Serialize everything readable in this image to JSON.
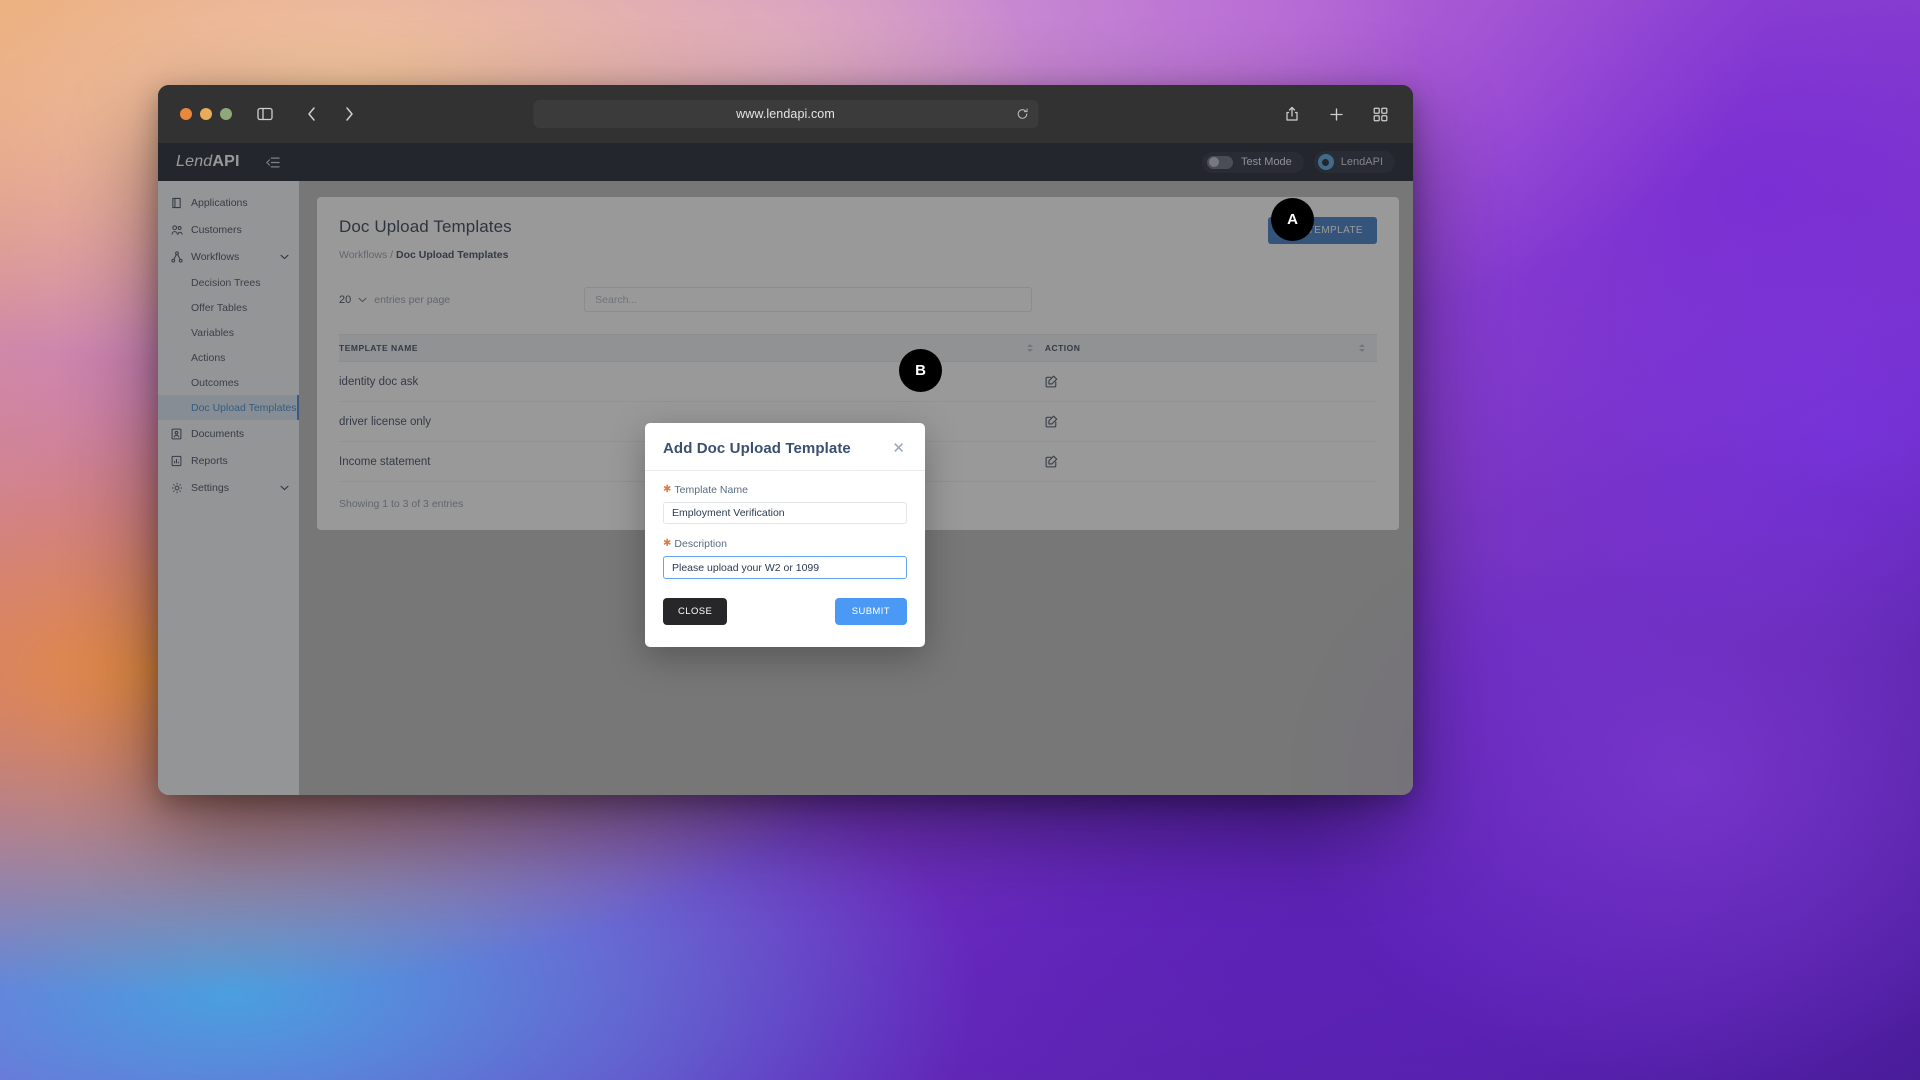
{
  "browser": {
    "url": "www.lendapi.com",
    "traffic_lights": [
      "close",
      "minimize",
      "maximize"
    ],
    "icons": {
      "sidebar_toggle": "sidebar-toggle-icon",
      "back": "back-arrow-icon",
      "forward": "forward-arrow-icon",
      "reload": "reload-icon",
      "share": "share-icon",
      "new_tab": "plus-icon",
      "tab_overview": "tab-grid-icon"
    }
  },
  "app": {
    "brand": {
      "part1": "Lend",
      "part2": "API"
    },
    "collapse_icon": "collapse-menu-icon",
    "test_mode": {
      "label": "Test Mode",
      "enabled": false
    },
    "user": {
      "name": "LendAPI"
    }
  },
  "sidebar": {
    "items": [
      {
        "label": "Applications",
        "icon": "applications-icon",
        "type": "item",
        "expandable": false
      },
      {
        "label": "Customers",
        "icon": "customers-icon",
        "type": "item",
        "expandable": false
      },
      {
        "label": "Workflows",
        "icon": "workflows-icon",
        "type": "item",
        "expandable": true,
        "expanded": true
      },
      {
        "label": "Decision Trees",
        "type": "sub",
        "active": false
      },
      {
        "label": "Offer Tables",
        "type": "sub",
        "active": false
      },
      {
        "label": "Variables",
        "type": "sub",
        "active": false
      },
      {
        "label": "Actions",
        "type": "sub",
        "active": false
      },
      {
        "label": "Outcomes",
        "type": "sub",
        "active": false
      },
      {
        "label": "Doc Upload Templates",
        "type": "sub",
        "active": true
      },
      {
        "label": "Documents",
        "icon": "documents-icon",
        "type": "item",
        "expandable": false
      },
      {
        "label": "Reports",
        "icon": "reports-icon",
        "type": "item",
        "expandable": false
      },
      {
        "label": "Settings",
        "icon": "settings-gear-icon",
        "type": "item",
        "expandable": true,
        "expanded": false
      }
    ]
  },
  "page": {
    "title": "Doc Upload Templates",
    "breadcrumb": {
      "parent": "Workflows",
      "separator": "/",
      "current": "Doc Upload Templates"
    },
    "add_button": "ADD TEMPLATE"
  },
  "table_controls": {
    "entries_value": "20",
    "entries_label": "entries per page",
    "search_placeholder": "Search..."
  },
  "table": {
    "columns": [
      "TEMPLATE NAME",
      "ACTION"
    ],
    "rows": [
      {
        "name": "identity doc ask",
        "action_icon": "edit-icon"
      },
      {
        "name": "driver license only",
        "action_icon": "edit-icon"
      },
      {
        "name": "Income statement",
        "action_icon": "edit-icon"
      }
    ],
    "footer": "Showing 1 to 3 of 3 entries"
  },
  "modal": {
    "title": "Add Doc Upload Template",
    "close_icon": "close-x-icon",
    "fields": [
      {
        "label": "Template Name",
        "required": true,
        "value": "Employment Verification",
        "focused": false
      },
      {
        "label": "Description",
        "required": true,
        "value": "Please upload your W2 or 1099",
        "focused": true
      }
    ],
    "buttons": {
      "close": "CLOSE",
      "submit": "SUBMIT"
    }
  },
  "annotations": [
    {
      "id": "A",
      "label": "A"
    },
    {
      "id": "B",
      "label": "B"
    }
  ],
  "colors": {
    "accent_blue": "#2f6fc0",
    "submit_blue": "#4a9af5",
    "active_nav": "#2f7fd0",
    "required_star": "#e07a3f",
    "topbar_dark": "#0b1020"
  }
}
